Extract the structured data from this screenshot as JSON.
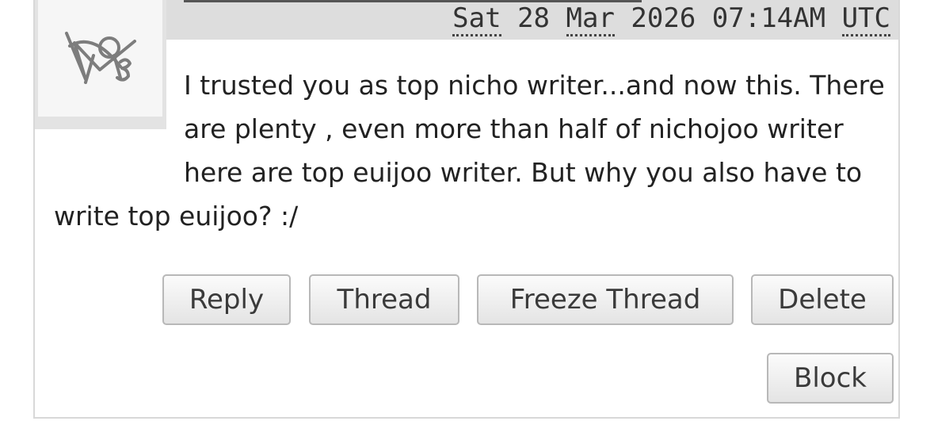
{
  "comment": {
    "timestamp": {
      "day": "Sat",
      "date": "28",
      "month": "Mar",
      "year": "2026",
      "time": "07:14AM",
      "timezone": "UTC"
    },
    "text": "I trusted you as top nicho writer...and now this. There are plenty , even more than half of nichojoo writer here are top euijoo writer. But why you also have to write top euijoo? :/"
  },
  "actions": {
    "reply": "Reply",
    "thread": "Thread",
    "freeze_thread": "Freeze Thread",
    "delete": "Delete",
    "block": "Block"
  },
  "colors": {
    "header_bg": "#dddddd",
    "border": "#d8d8d8",
    "button_border": "#b8b8b8"
  },
  "icons": {
    "avatar": "doodle-avatar-icon"
  }
}
